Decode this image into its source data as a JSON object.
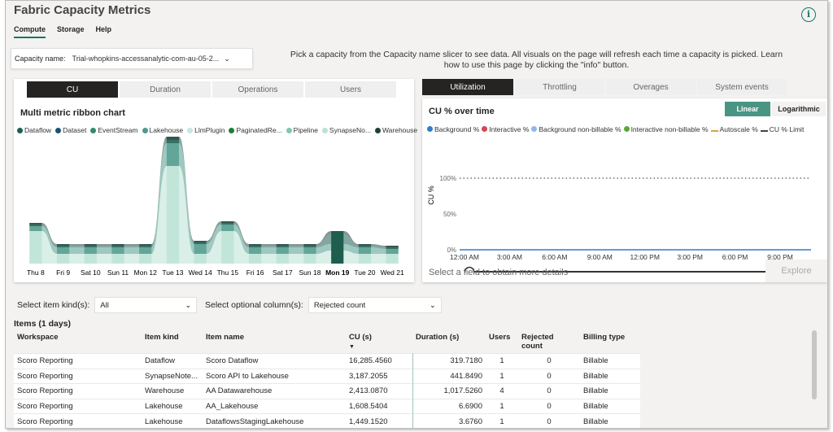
{
  "app": {
    "title": "Fabric Capacity Metrics",
    "tabs": [
      "Compute",
      "Storage",
      "Help"
    ]
  },
  "capacity": {
    "label": "Capacity name:",
    "value": "Trial-whopkins-accessanalytic-com-au-05-2..."
  },
  "hint": "Pick a capacity from the Capacity name slicer to see data. All visuals on the page will refresh each time a capacity is picked. Learn how to use this page by clicking the \"info\" button.",
  "left_panel": {
    "segments": [
      "CU",
      "Duration",
      "Operations",
      "Users"
    ],
    "title": "Multi metric ribbon chart",
    "legend": [
      {
        "name": "Dataflow",
        "color": "#1d5e52"
      },
      {
        "name": "Dataset",
        "color": "#1a5276"
      },
      {
        "name": "EventStream",
        "color": "#2e8b74"
      },
      {
        "name": "Lakehouse",
        "color": "#4f9a8c"
      },
      {
        "name": "LlmPlugin",
        "color": "#c5e8df"
      },
      {
        "name": "PaginatedRe...",
        "color": "#1e7d3a"
      },
      {
        "name": "Pipeline",
        "color": "#7fc8b3"
      },
      {
        "name": "SynapseNo...",
        "color": "#b9e2d6"
      },
      {
        "name": "Warehouse",
        "color": "#1f3f37"
      }
    ]
  },
  "chart_data": {
    "type": "area",
    "title": "Multi metric ribbon chart",
    "categories": [
      "Thu 8",
      "Fri 9",
      "Sat 10",
      "Sun 11",
      "Mon 12",
      "Tue 13",
      "Wed 14",
      "Thu 15",
      "Fri 16",
      "Sat 17",
      "Sun 18",
      "Mon 19",
      "Tue 20",
      "Wed 21"
    ],
    "selected_category": "Mon 19",
    "series": [
      {
        "name": "SynapseNo...",
        "values": [
          10,
          3,
          3,
          3,
          3,
          30,
          3,
          10,
          3,
          3,
          3,
          4,
          3,
          3
        ]
      },
      {
        "name": "Lakehouse",
        "values": [
          1.5,
          2,
          2,
          2,
          2,
          7,
          3,
          2,
          2,
          2,
          2,
          2,
          2,
          1.5
        ]
      },
      {
        "name": "Dataflow",
        "values": [
          0.5,
          0.5,
          0.5,
          0.5,
          0.5,
          1,
          0.5,
          0.5,
          0.5,
          0.5,
          0.5,
          3,
          0.5,
          0.5
        ]
      },
      {
        "name": "Warehouse",
        "values": [
          0.5,
          0.5,
          0.5,
          0.5,
          0.5,
          1,
          0.5,
          0.5,
          0.5,
          0.5,
          0.5,
          1,
          0.5,
          0.5
        ]
      }
    ]
  },
  "right_panel": {
    "tabs": [
      "Utilization",
      "Throttling",
      "Overages",
      "System events"
    ],
    "title": "CU % over time",
    "scale": [
      "Linear",
      "Logarithmic"
    ],
    "legend": [
      {
        "name": "Background %",
        "color": "#2f7fc9",
        "kind": "dot"
      },
      {
        "name": "Interactive %",
        "color": "#d64550",
        "kind": "dot"
      },
      {
        "name": "Background non-billable %",
        "color": "#8fb9e3",
        "kind": "dot"
      },
      {
        "name": "Interactive non-billable %",
        "color": "#5aa832",
        "kind": "dot"
      },
      {
        "name": "Autoscale %",
        "color": "#e0a040",
        "kind": "line"
      },
      {
        "name": "CU % Limit",
        "color": "#444444",
        "kind": "line"
      }
    ],
    "y_axis_label": "CU %",
    "y_ticks": [
      "100%",
      "50%",
      "0%"
    ],
    "x_ticks": [
      "12:00 AM",
      "3:00 AM",
      "6:00 AM",
      "9:00 AM",
      "12:00 PM",
      "3:00 PM",
      "6:00 PM",
      "9:00 PM"
    ],
    "select_hint": "Select a field to obtain more details",
    "explore": "Explore"
  },
  "cu_chart": {
    "type": "line",
    "ylim": [
      0,
      100
    ],
    "limit_value": 100,
    "series": [
      {
        "name": "Background %",
        "value": 0
      }
    ]
  },
  "filters": {
    "item_kind_label": "Select item kind(s):",
    "item_kind_value": "All",
    "optional_label": "Select optional column(s):",
    "optional_value": "Rejected count"
  },
  "items": {
    "title": "Items (1 days)",
    "columns": [
      "Workspace",
      "Item kind",
      "Item name",
      "CU (s)",
      "Duration (s)",
      "Users",
      "Rejected count",
      "Billing type"
    ],
    "rows": [
      [
        "Scoro Reporting",
        "Dataflow",
        "Scoro Dataflow",
        "16,285.4560",
        "319.7180",
        "1",
        "0",
        "Billable"
      ],
      [
        "Scoro Reporting",
        "SynapseNote...",
        "Scoro API to Lakehouse",
        "3,187.2055",
        "441.8490",
        "1",
        "0",
        "Billable"
      ],
      [
        "Scoro Reporting",
        "Warehouse",
        "AA Datawarehouse",
        "2,413.0870",
        "1,017.5260",
        "4",
        "0",
        "Billable"
      ],
      [
        "Scoro Reporting",
        "Lakehouse",
        "AA_Lakehouse",
        "1,608.5404",
        "6.6900",
        "1",
        "0",
        "Billable"
      ],
      [
        "Scoro Reporting",
        "Lakehouse",
        "DataflowsStagingLakehouse",
        "1,449.1520",
        "3.6760",
        "1",
        "0",
        "Billable"
      ]
    ]
  }
}
